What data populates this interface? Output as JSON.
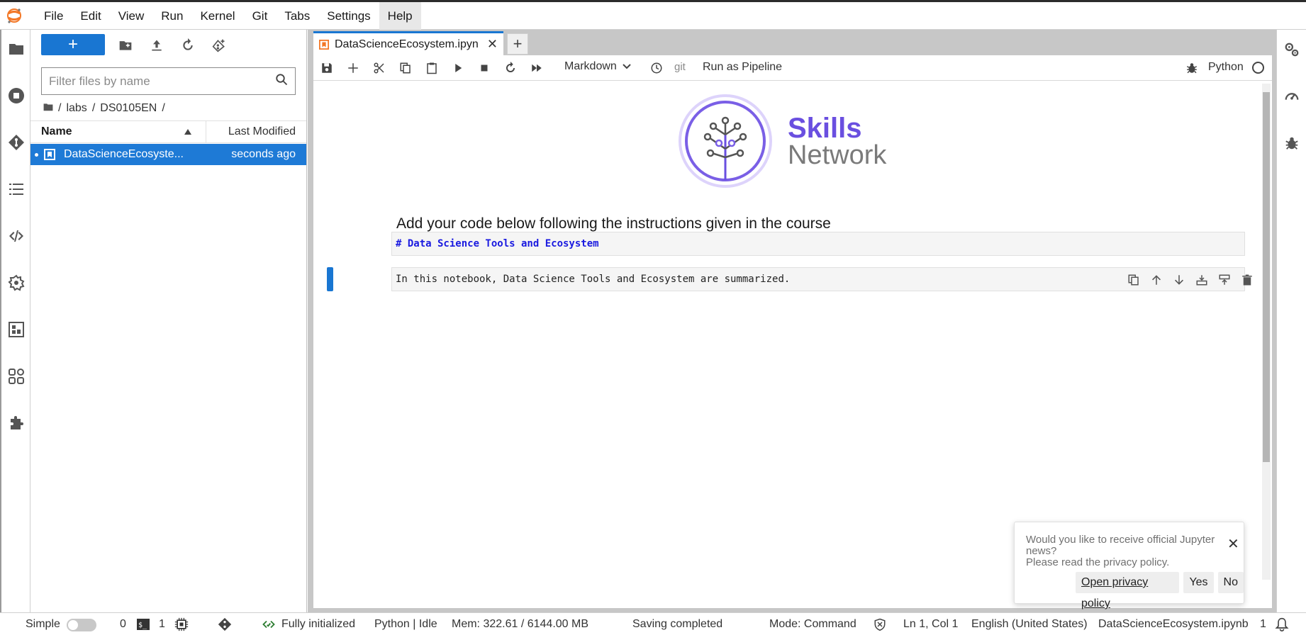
{
  "menu": {
    "items": [
      "File",
      "Edit",
      "View",
      "Run",
      "Kernel",
      "Git",
      "Tabs",
      "Settings",
      "Help"
    ]
  },
  "file_browser": {
    "filter_placeholder": "Filter files by name",
    "breadcrumbs": [
      "/",
      "labs",
      "/",
      "DS0105EN",
      "/"
    ],
    "columns": {
      "name": "Name",
      "modified": "Last Modified"
    },
    "files": [
      {
        "name": "DataScienceEcosyste...",
        "modified": "seconds ago"
      }
    ]
  },
  "tabs": {
    "notebook_tab": "DataScienceEcosystem.ipyn"
  },
  "notebook_toolbar": {
    "cell_type": "Markdown",
    "git": "git",
    "pipeline": "Run as Pipeline",
    "kernel": "Python"
  },
  "notebook": {
    "logo_line1": "Skills",
    "logo_line2": "Network",
    "heading": "Add your code below following the instructions given in the course",
    "cell1": "# Data Science Tools and Ecosystem",
    "cell2": "In this notebook, Data Science Tools and Ecosystem are summarized."
  },
  "notification": {
    "message_line1": "Would you like to receive official Jupyter news?",
    "message_line2": "Please read the privacy policy.",
    "privacy_button": "Open privacy policy",
    "yes_button": "Yes",
    "no_button": "No"
  },
  "status_bar": {
    "simple_label": "Simple",
    "terminals_count": "0",
    "kernels_count": "1",
    "init_status": "Fully initialized",
    "kernel_status": "Python | Idle",
    "memory": "Mem: 322.61 / 6144.00 MB",
    "save_status": "Saving completed",
    "mode": "Mode: Command",
    "cursor": "Ln 1, Col 1",
    "language": "English (United States)",
    "filename": "DataScienceEcosystem.ipynb",
    "notifications_count": "1"
  },
  "colors": {
    "accent": "#1976d2",
    "skills_purple": "#6a4fe0",
    "network_gray": "#7a7a7a"
  }
}
